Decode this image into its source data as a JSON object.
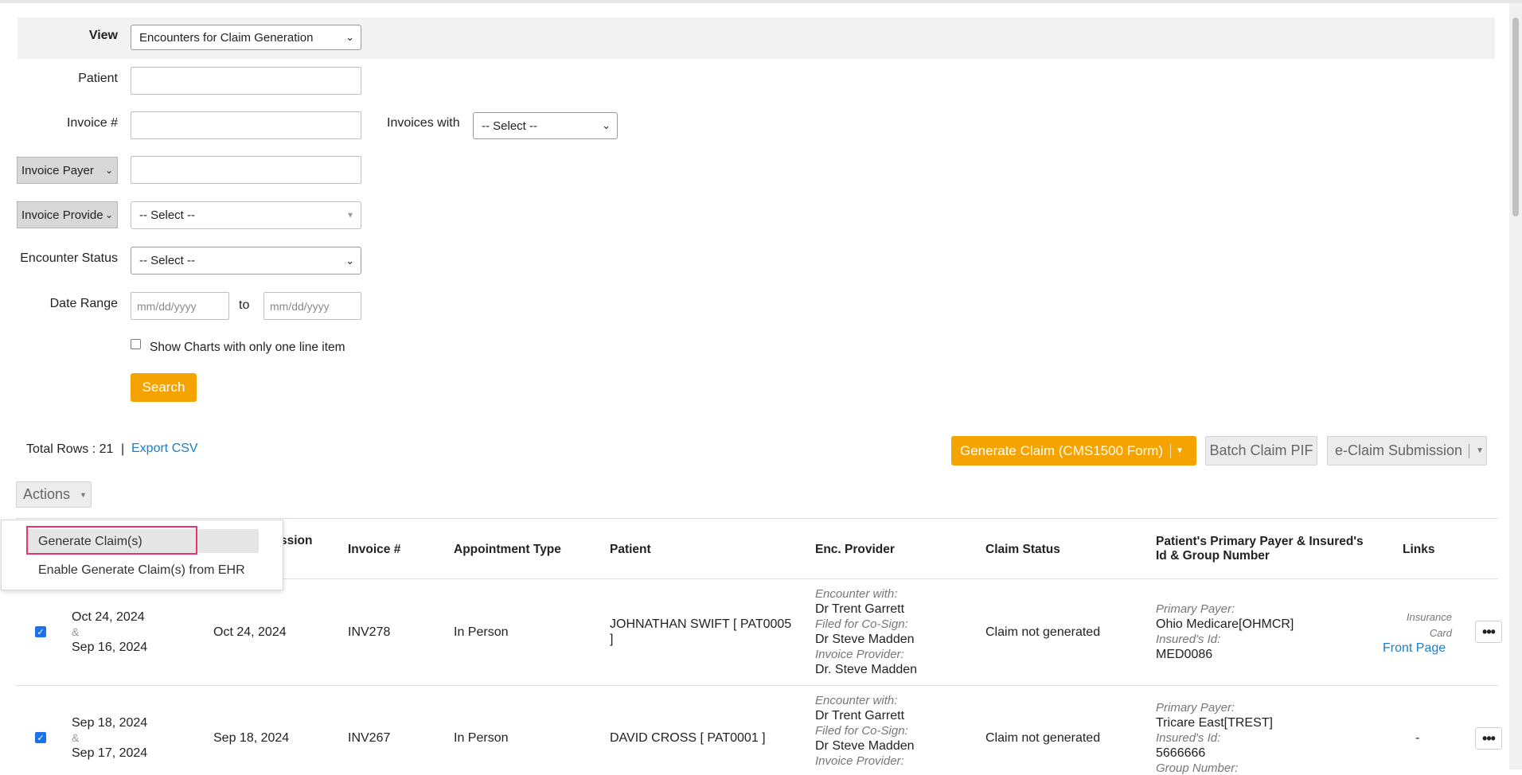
{
  "filters": {
    "view_label": "View",
    "view_value": "Encounters for Claim Generation",
    "patient_label": "Patient",
    "invoice_label": "Invoice #",
    "invoices_with_label": "Invoices with",
    "invoices_with_value": "-- Select --",
    "payer_type": "Invoice Payer",
    "provider_type": "Invoice Provider",
    "provider_value": "-- Select --",
    "encounter_status_label": "Encounter Status",
    "encounter_status_value": "-- Select --",
    "date_range_label": "Date Range",
    "date_from_placeholder": "mm/dd/yyyy",
    "to_label": "to",
    "date_to_placeholder": "mm/dd/yyyy",
    "one_line_label": "Show Charts with only one line item",
    "search_label": "Search"
  },
  "toolbar": {
    "total_rows_label": "Total Rows : 21",
    "separator": "|",
    "export_label": "Export CSV",
    "generate_claim_label": "Generate Claim (CMS1500 Form)",
    "batch_claim_label": "Batch Claim PIF",
    "eclaim_label": "e-Claim Submission",
    "actions_label": "Actions"
  },
  "actions_menu": {
    "items": [
      "Generate Claim(s)",
      "Enable Generate Claim(s) from EHR"
    ]
  },
  "table": {
    "headers": {
      "admission_partial": "ssion",
      "invoice": "Invoice #",
      "appointment_type": "Appointment Type",
      "patient": "Patient",
      "enc_provider": "Enc. Provider",
      "claim_status": "Claim Status",
      "payer_line1": "Patient's Primary Payer & Insured's",
      "payer_line2": "Id & Group Number",
      "links": "Links"
    },
    "rows": [
      {
        "checked": true,
        "date1": "Oct 24, 2024",
        "amp": "&",
        "date2": "Sep 16, 2024",
        "admission": "Oct 24, 2024",
        "invoice": "INV278",
        "appointment_type": "In Person",
        "patient_line1": "JOHNATHAN SWIFT [ PAT0005",
        "patient_line2": "]",
        "enc_with_label": "Encounter with:",
        "enc_with": "Dr Trent Garrett",
        "cosign_label": "Filed for Co-Sign:",
        "cosign": "Dr Steve Madden",
        "inv_provider_label": "Invoice Provider:",
        "inv_provider": "Dr. Steve Madden",
        "claim_status": "Claim not generated",
        "primary_payer_label": "Primary Payer:",
        "primary_payer": "Ohio Medicare[OHMCR]",
        "insured_id_label": "Insured's Id:",
        "insured_id": "MED0086",
        "link_card1": "Insurance",
        "link_card2": "Card",
        "link_front": "Front Page",
        "more": "•••"
      },
      {
        "checked": true,
        "date1": "Sep 18, 2024",
        "amp": "&",
        "date2": "Sep 17, 2024",
        "admission": "Sep 18, 2024",
        "invoice": "INV267",
        "appointment_type": "In Person",
        "patient_line1": "DAVID CROSS [ PAT0001 ]",
        "enc_with_label": "Encounter with:",
        "enc_with": "Dr Trent Garrett",
        "cosign_label": "Filed for Co-Sign:",
        "cosign": "Dr Steve Madden",
        "inv_provider_label": "Invoice Provider:",
        "claim_status": "Claim not generated",
        "primary_payer_label": "Primary Payer:",
        "primary_payer": "Tricare East[TREST]",
        "insured_id_label": "Insured's Id:",
        "insured_id": "5666666",
        "group_number_label": "Group Number:",
        "links": "-",
        "more": "•••"
      }
    ]
  },
  "colors": {
    "accent_orange": "#f5a300",
    "link_blue": "#1a7ec8",
    "highlight_pink": "#e8336b",
    "checkbox_blue": "#1a73e8"
  }
}
